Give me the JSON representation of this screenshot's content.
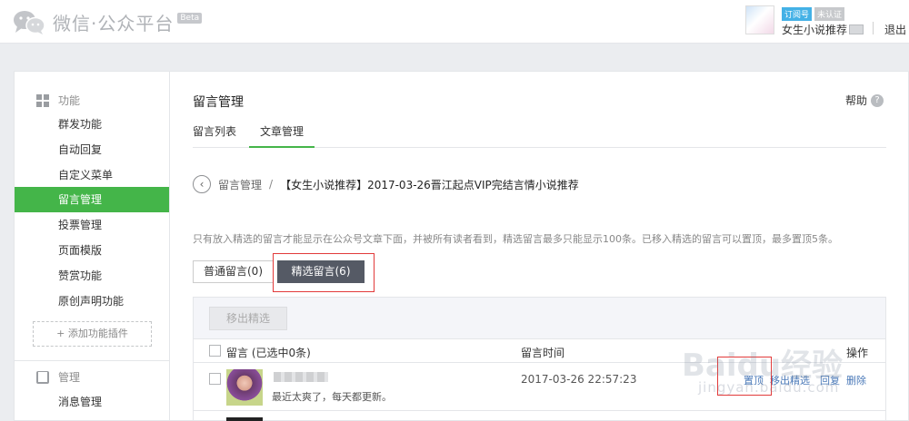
{
  "header": {
    "logo_text": "微信·公众平台",
    "beta": "Beta",
    "badge_type": "订阅号",
    "badge_status": "未认证",
    "account_name": "女生小说推荐",
    "logout": "退出"
  },
  "sidebar": {
    "section_function": "功能",
    "items": [
      {
        "label": "群发功能"
      },
      {
        "label": "自动回复"
      },
      {
        "label": "自定义菜单"
      },
      {
        "label": "留言管理"
      },
      {
        "label": "投票管理"
      },
      {
        "label": "页面模版"
      },
      {
        "label": "赞赏功能"
      },
      {
        "label": "原创声明功能"
      }
    ],
    "add_plugin": "+ 添加功能插件",
    "section_manage": "管理",
    "manage_items": [
      {
        "label": "消息管理"
      }
    ]
  },
  "main": {
    "title": "留言管理",
    "help": "帮助",
    "tabs": [
      {
        "label": "留言列表"
      },
      {
        "label": "文章管理"
      }
    ],
    "breadcrumb_root": "留言管理",
    "breadcrumb_sep": "/",
    "breadcrumb_current": "【女生小说推荐】2017-03-26晋江起点VIP完结言情小说推荐",
    "notice": "只有放入精选的留言才能显示在公众号文章下面，并被所有读者看到，精选留言最多只能显示100条。已移入精选的留言可以置顶，最多置顶5条。",
    "seg_normal": "普通留言(0)",
    "seg_picked": "精选留言(6)",
    "btn_remove": "移出精选",
    "col_comment": "留言 (已选中0条)",
    "col_time": "留言时间",
    "col_ops": "操作",
    "rows": [
      {
        "text": "最近太爽了，每天都更新。",
        "time": "2017-03-26 22:57:23",
        "ops": [
          "置顶",
          "移出精选",
          "回复",
          "删除"
        ]
      }
    ]
  },
  "watermark": {
    "main": "Baidu经验",
    "sub": "jingyan.baidu.com"
  },
  "colors": {
    "accent_green": "#44b549",
    "active_segment": "#555a65",
    "link_blue": "#4a79b8",
    "highlight_red": "#e23a3a"
  }
}
